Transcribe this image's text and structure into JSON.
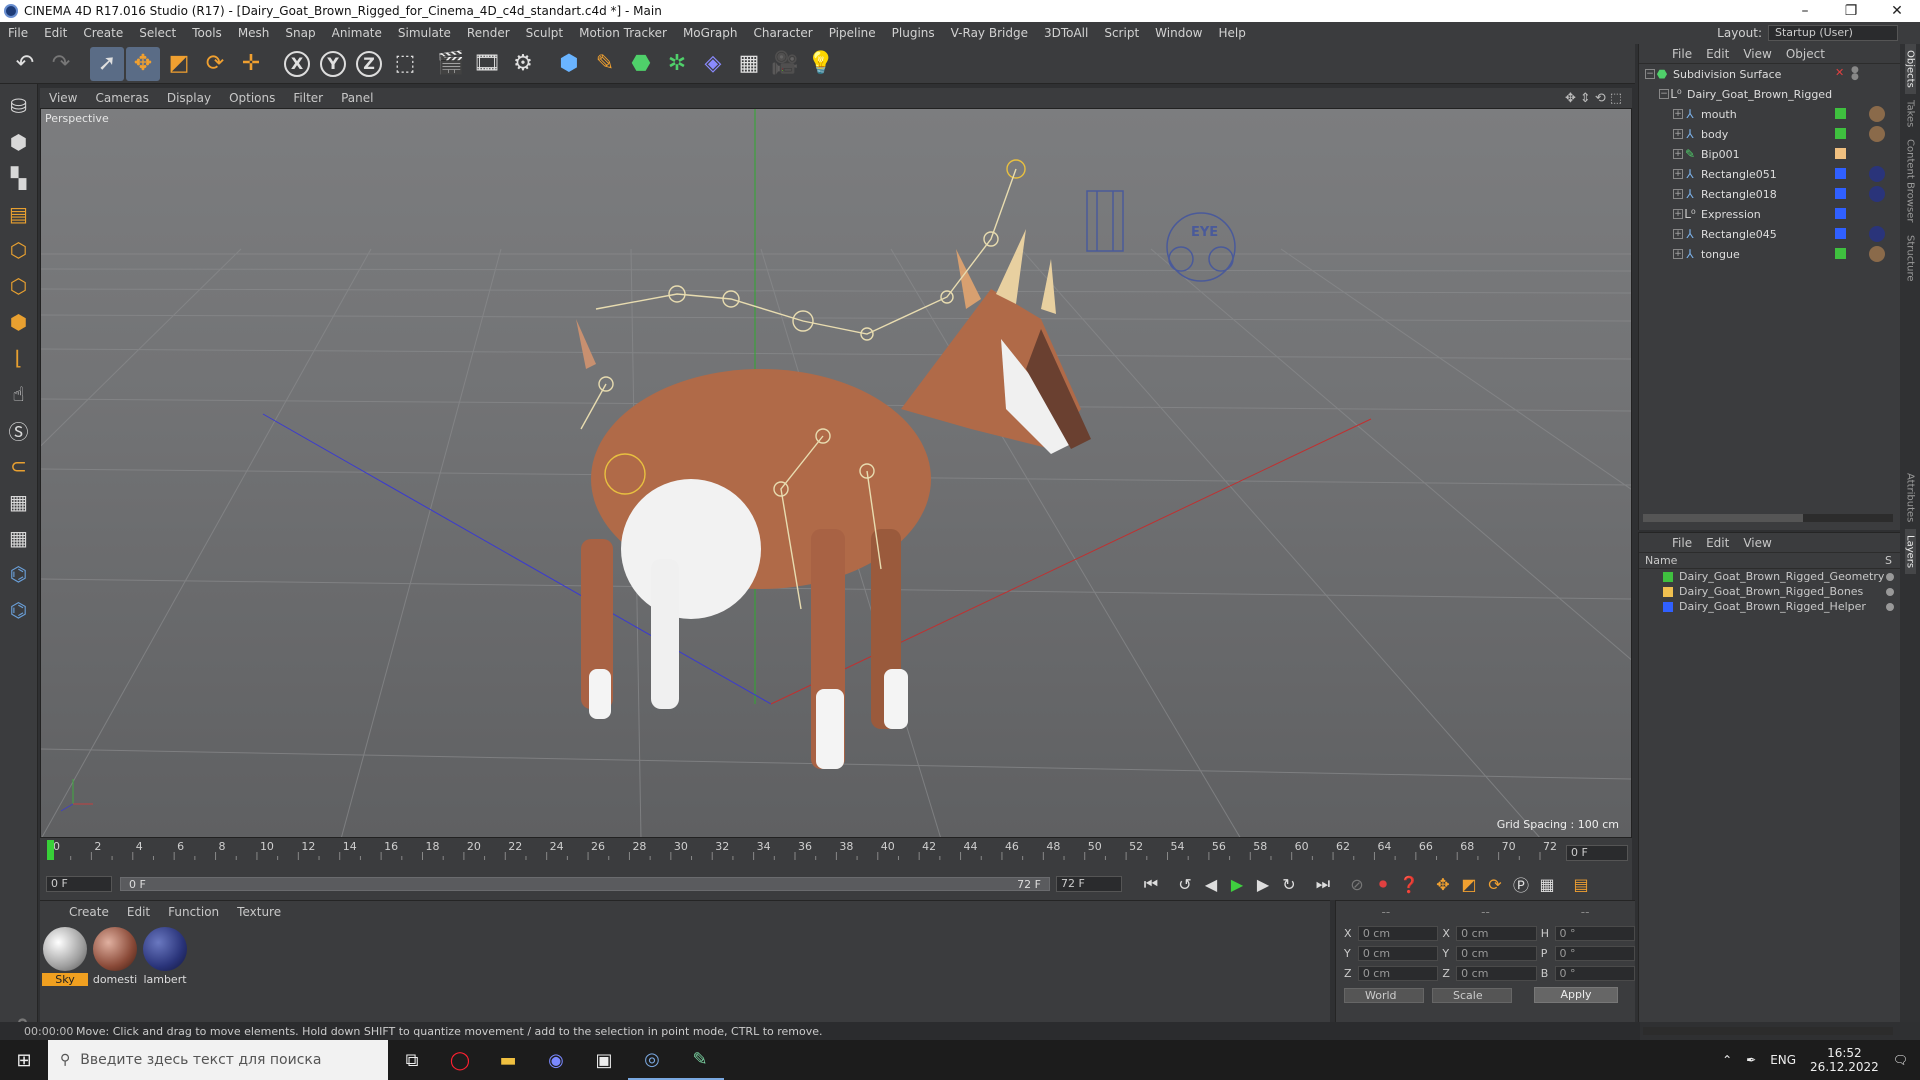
{
  "window": {
    "title": "CINEMA 4D R17.016 Studio (R17) - [Dairy_Goat_Brown_Rigged_for_Cinema_4D_c4d_standart.c4d *] - Main",
    "controls": [
      "–",
      "❐",
      "✕"
    ]
  },
  "menubar": {
    "items": [
      "File",
      "Edit",
      "Create",
      "Select",
      "Tools",
      "Mesh",
      "Snap",
      "Animate",
      "Simulate",
      "Render",
      "Sculpt",
      "Motion Tracker",
      "MoGraph",
      "Character",
      "Pipeline",
      "Plugins",
      "V-Ray Bridge",
      "3DToAll",
      "Script",
      "Window",
      "Help"
    ],
    "layout_label": "Layout:",
    "layout_value": "Startup (User)"
  },
  "toolbar": {
    "axes": [
      "X",
      "Y",
      "Z"
    ]
  },
  "viewport": {
    "menu": [
      "View",
      "Cameras",
      "Display",
      "Options",
      "Filter",
      "Panel"
    ],
    "label": "Perspective",
    "grid_spacing": "Grid Spacing : 100 cm",
    "rig_label": "EYE"
  },
  "timeline": {
    "ticks": [
      0,
      2,
      4,
      6,
      8,
      10,
      12,
      14,
      16,
      18,
      20,
      22,
      24,
      26,
      28,
      30,
      32,
      34,
      36,
      38,
      40,
      42,
      44,
      46,
      48,
      50,
      52,
      54,
      56,
      58,
      60,
      62,
      64,
      66,
      68,
      70,
      72
    ],
    "max": 72,
    "current_frame": "0 F"
  },
  "transport": {
    "start_field": "0 F",
    "range_start": "0 F",
    "range_end": "72 F",
    "end_field": "72 F"
  },
  "materials": {
    "menu": [
      "Create",
      "Edit",
      "Function",
      "Texture"
    ],
    "items": [
      {
        "label": "Sky",
        "selected": true
      },
      {
        "label": "domesti",
        "selected": false
      },
      {
        "label": "lambert",
        "selected": false
      }
    ]
  },
  "coordinates": {
    "headers": [
      "--",
      "--",
      "--"
    ],
    "rows": [
      {
        "a": "X",
        "a_val": "0 cm",
        "b": "X",
        "b_val": "0 cm",
        "c": "H",
        "c_val": "0 °"
      },
      {
        "a": "Y",
        "a_val": "0 cm",
        "b": "Y",
        "b_val": "0 cm",
        "c": "P",
        "c_val": "0 °"
      },
      {
        "a": "Z",
        "a_val": "0 cm",
        "b": "Z",
        "b_val": "0 cm",
        "c": "B",
        "c_val": "0 °"
      }
    ],
    "world": "World",
    "scale": "Scale",
    "apply": "Apply"
  },
  "status": {
    "time": "00:00:00",
    "message": "Move: Click and drag to move elements. Hold down SHIFT to quantize movement / add to the selection in point mode, CTRL to remove."
  },
  "objects": {
    "menu": [
      "File",
      "Edit",
      "View",
      "Object"
    ],
    "root": "Subdivision Surface",
    "group": "Dairy_Goat_Brown_Rigged",
    "children": [
      {
        "name": "mouth",
        "color": "#3fc03f"
      },
      {
        "name": "body",
        "color": "#3fc03f"
      },
      {
        "name": "Bip001",
        "color": "#f0c080"
      },
      {
        "name": "Rectangle051",
        "color": "#3060ff"
      },
      {
        "name": "Rectangle018",
        "color": "#3060ff"
      },
      {
        "name": "Expression",
        "color": "#3060ff"
      },
      {
        "name": "Rectangle045",
        "color": "#3060ff"
      },
      {
        "name": "tongue",
        "color": "#3fc03f"
      }
    ]
  },
  "layers": {
    "menu": [
      "File",
      "Edit",
      "View"
    ],
    "name_header": "Name",
    "s_header": "S",
    "items": [
      {
        "name": "Dairy_Goat_Brown_Rigged_Geometry",
        "color": "#3fc03f"
      },
      {
        "name": "Dairy_Goat_Brown_Rigged_Bones",
        "color": "#f0c050"
      },
      {
        "name": "Dairy_Goat_Brown_Rigged_Helper",
        "color": "#3060ff"
      }
    ]
  },
  "right_tabs": [
    "Objects",
    "Takes",
    "Content Browser",
    "Structure",
    "Attributes",
    "Layers"
  ],
  "taskbar": {
    "search_placeholder": "Введите здесь текст для поиска",
    "lang": "ENG",
    "time": "16:52",
    "date": "26.12.2022"
  }
}
